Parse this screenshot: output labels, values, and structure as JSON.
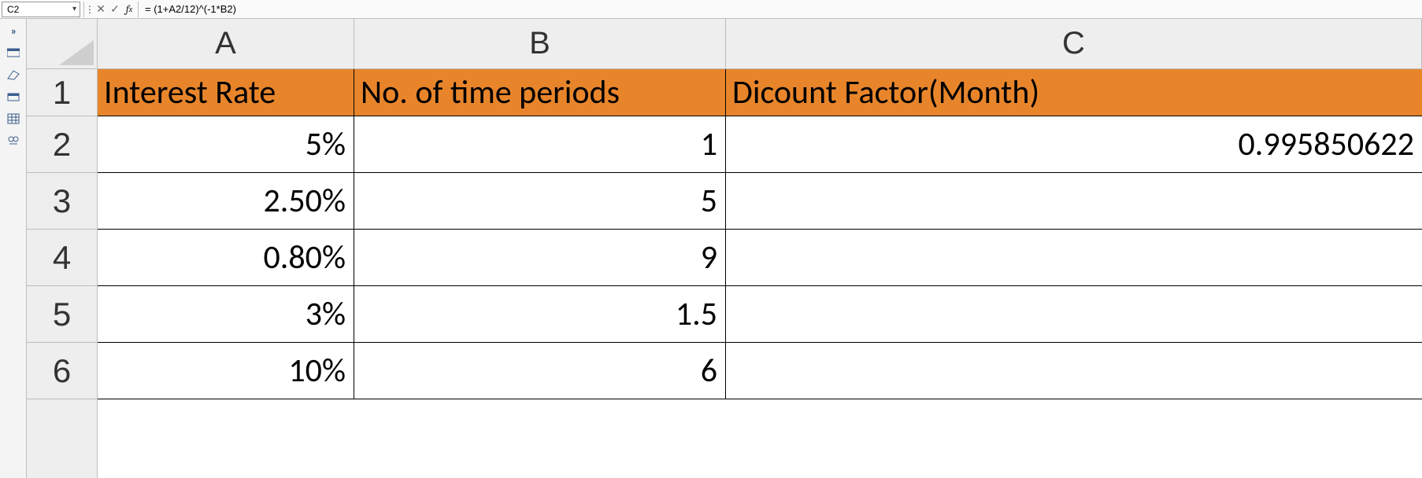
{
  "name_box": {
    "value": "C2"
  },
  "formula_bar": {
    "value": "= (1+A2/12)^(-1*B2)"
  },
  "columns": {
    "A": "A",
    "B": "B",
    "C": "C"
  },
  "row_numbers": [
    "1",
    "2",
    "3",
    "4",
    "5",
    "6"
  ],
  "headers": {
    "A": "Interest Rate",
    "B": "No. of time periods",
    "C": "Dicount Factor(Month)"
  },
  "rows": [
    {
      "A": "5%",
      "B": "1",
      "C": "0.995850622"
    },
    {
      "A": "2.50%",
      "B": "5",
      "C": ""
    },
    {
      "A": "0.80%",
      "B": "9",
      "C": ""
    },
    {
      "A": "3%",
      "B": "1.5",
      "C": ""
    },
    {
      "A": "10%",
      "B": "6",
      "C": ""
    }
  ],
  "theme": {
    "header_bg": "#e8852b"
  }
}
